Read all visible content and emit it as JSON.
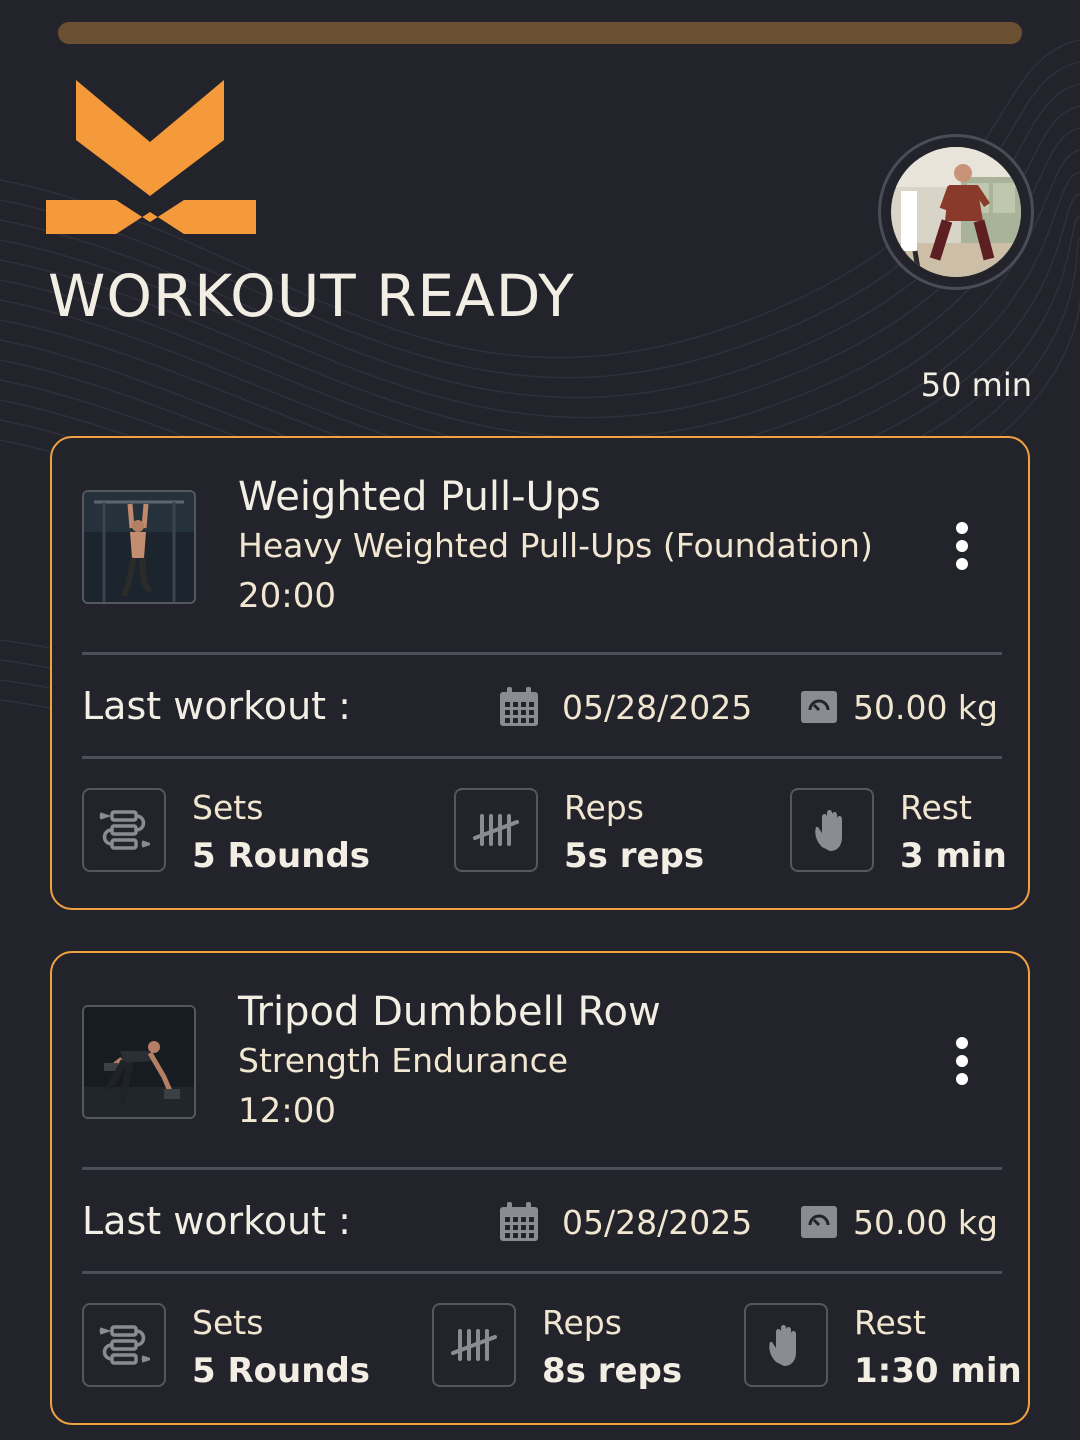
{
  "header": {
    "title": "WORKOUT READY",
    "duration": "50 min",
    "progress_fraction": 1.0,
    "logo_icon": "x-brand-logo-icon",
    "avatar_icon": "trainer-avatar-photo"
  },
  "colors": {
    "accent": "#f1a240",
    "background": "#23232b",
    "progress": "#6b4f33",
    "divider": "#4c4e58",
    "icon_gray": "#8a8c93"
  },
  "exercises": [
    {
      "name": "Weighted Pull-Ups",
      "subtitle": "Heavy Weighted Pull-Ups (Foundation)",
      "time": "20:00",
      "thumb_icon": "pull-up-photo",
      "last_workout_label": "Last workout :",
      "last_date": "05/28/2025",
      "last_weight": "50.00 kg",
      "sets_label": "Sets",
      "sets_value": "5 Rounds",
      "reps_label": "Reps",
      "reps_value": "5s reps",
      "rest_label": "Rest",
      "rest_value": "3 min"
    },
    {
      "name": "Tripod Dumbbell Row",
      "subtitle": "Strength Endurance",
      "time": "12:00",
      "thumb_icon": "dumbbell-row-photo",
      "last_workout_label": "Last workout :",
      "last_date": "05/28/2025",
      "last_weight": "50.00 kg",
      "sets_label": "Sets",
      "sets_value": "5 Rounds",
      "reps_label": "Reps",
      "reps_value": "8s reps",
      "rest_label": "Rest",
      "rest_value": "1:30 min"
    }
  ]
}
